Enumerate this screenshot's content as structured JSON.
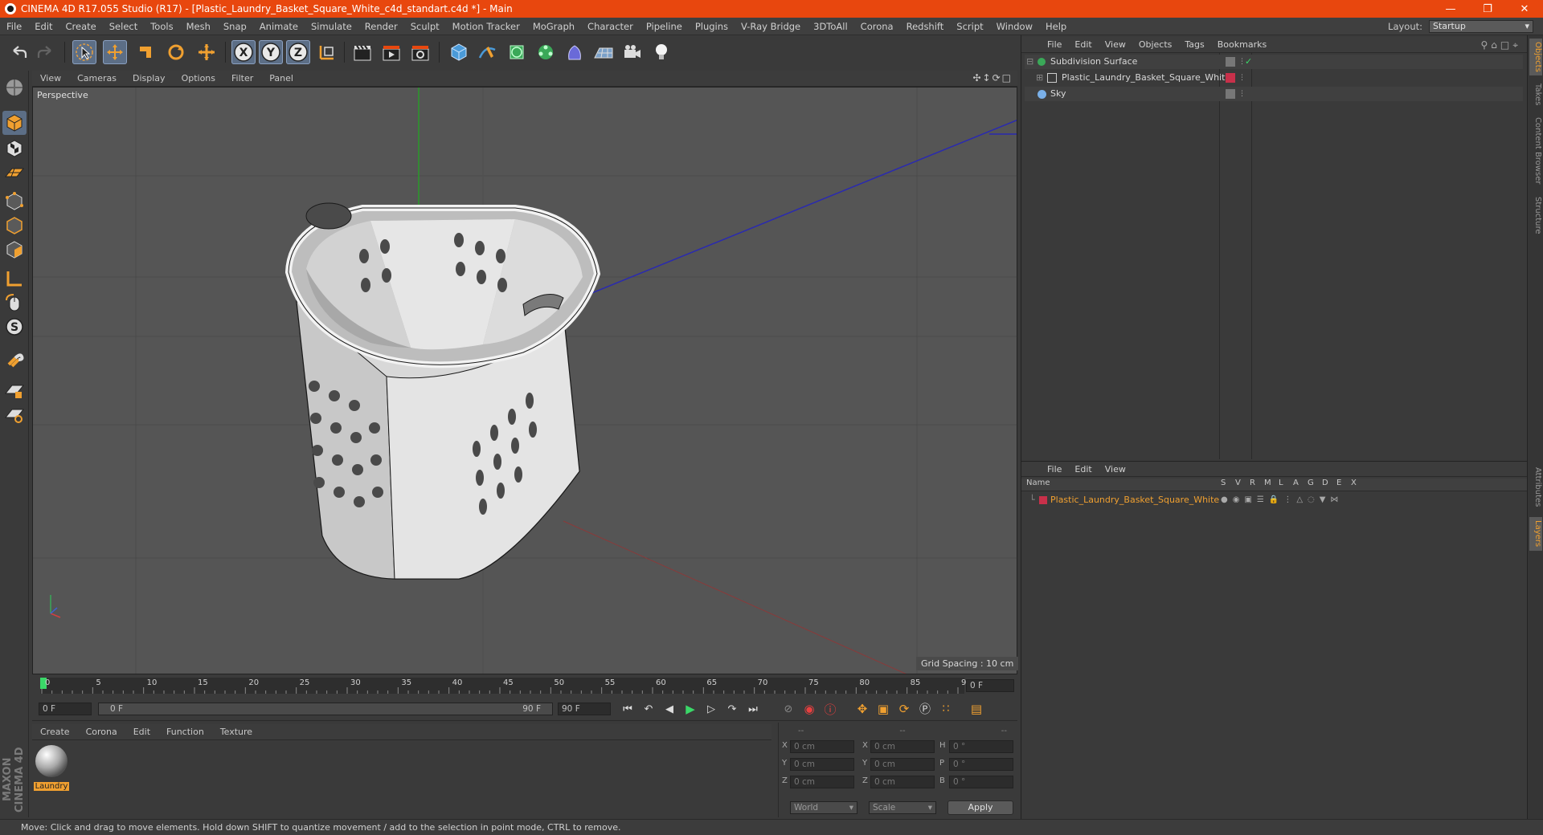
{
  "window": {
    "title": "CINEMA 4D R17.055 Studio (R17) - [Plastic_Laundry_Basket_Square_White_c4d_standart.c4d *] - Main",
    "minimize": "—",
    "restore": "❐",
    "close": "✕"
  },
  "menubar": {
    "items": [
      "File",
      "Edit",
      "Create",
      "Select",
      "Tools",
      "Mesh",
      "Snap",
      "Animate",
      "Simulate",
      "Render",
      "Sculpt",
      "Motion Tracker",
      "MoGraph",
      "Character",
      "Pipeline",
      "Plugins",
      "V-Ray Bridge",
      "3DToAll",
      "Corona",
      "Redshift",
      "Script",
      "Window",
      "Help"
    ],
    "layout_label": "Layout:",
    "layout_value": "Startup"
  },
  "viewport": {
    "menu": [
      "View",
      "Cameras",
      "Display",
      "Options",
      "Filter",
      "Panel"
    ],
    "label": "Perspective",
    "grid_spacing": "Grid Spacing : 10 cm"
  },
  "timeline": {
    "ticks": [
      "0",
      "5",
      "10",
      "15",
      "20",
      "25",
      "30",
      "35",
      "40",
      "45",
      "50",
      "55",
      "60",
      "65",
      "70",
      "75",
      "80",
      "85",
      "90"
    ],
    "current_frame": "0 F",
    "start_field": "0 F",
    "range_start": "0 F",
    "range_end": "90 F",
    "end_field": "90 F"
  },
  "material_panel": {
    "menu": [
      "Create",
      "Corona",
      "Edit",
      "Function",
      "Texture"
    ],
    "material_name": "Laundry"
  },
  "coord_panel": {
    "headers": [
      "--",
      "--",
      "--"
    ],
    "rows": [
      {
        "a": "X",
        "av": "0 cm",
        "b": "X",
        "bv": "0 cm",
        "c": "H",
        "cv": "0 °"
      },
      {
        "a": "Y",
        "av": "0 cm",
        "b": "Y",
        "bv": "0 cm",
        "c": "P",
        "cv": "0 °"
      },
      {
        "a": "Z",
        "av": "0 cm",
        "b": "Z",
        "bv": "0 cm",
        "c": "B",
        "cv": "0 °"
      }
    ],
    "world": "World",
    "scale": "Scale",
    "apply": "Apply"
  },
  "status": "Move: Click and drag to move elements. Hold down SHIFT to quantize movement / add to the selection in point mode, CTRL to remove.",
  "objects_panel": {
    "menu": [
      "File",
      "Edit",
      "View",
      "Objects",
      "Tags",
      "Bookmarks"
    ],
    "items": [
      "Subdivision Surface",
      "Plastic_Laundry_Basket_Square_White",
      "Sky"
    ]
  },
  "layers_panel": {
    "menu": [
      "File",
      "Edit",
      "View"
    ],
    "columns": [
      "Name",
      "S",
      "V",
      "R",
      "M",
      "L",
      "A",
      "G",
      "D",
      "E",
      "X"
    ],
    "layer_name": "Plastic_Laundry_Basket_Square_White"
  },
  "side_tabs": [
    "Objects",
    "Takes",
    "Content Browser",
    "Structure",
    "Attributes",
    "Layers"
  ],
  "brand": "MAXON CINEMA 4D",
  "colors": {
    "titlebar": "#e8470e",
    "accent_orange": "#f0a030",
    "selected_tool": "#5c6e86",
    "layer_red": "#c8304a"
  }
}
